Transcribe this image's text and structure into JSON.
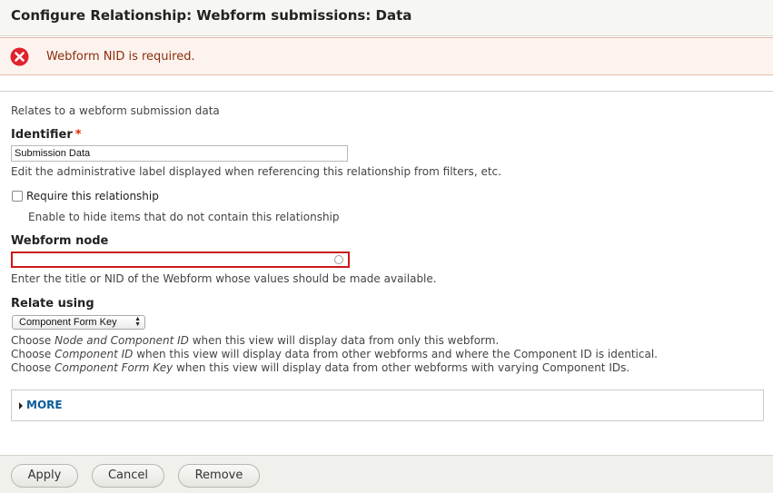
{
  "dialog": {
    "title": "Configure Relationship: Webform submissions: Data"
  },
  "error": {
    "message": "Webform NID is required."
  },
  "form": {
    "intro": "Relates to a webform submission data",
    "identifier": {
      "label": "Identifier",
      "required_marker": "*",
      "value": "Submission Data",
      "description": "Edit the administrative label displayed when referencing this relationship from filters, etc."
    },
    "require_relationship": {
      "label": "Require this relationship",
      "checked": false,
      "description": "Enable to hide items that do not contain this relationship"
    },
    "webform_node": {
      "label": "Webform node",
      "value": "",
      "description": "Enter the title or NID of the Webform whose values should be made available."
    },
    "relate_using": {
      "label": "Relate using",
      "selected": "Component Form Key",
      "help": [
        {
          "pre": "Choose ",
          "em": "Node and Component ID",
          "post": " when this view will display data from only this webform."
        },
        {
          "pre": "Choose ",
          "em": "Component ID",
          "post": " when this view will display data from other webforms and where the Component ID is identical."
        },
        {
          "pre": "Choose ",
          "em": "Component Form Key",
          "post": " when this view will display data from other webforms with varying Component IDs."
        }
      ]
    },
    "more": {
      "label": "MORE"
    }
  },
  "buttons": {
    "apply": "Apply",
    "cancel": "Cancel",
    "remove": "Remove"
  },
  "colors": {
    "error_text": "#8c2e0b",
    "error_background": "#fcf3ee",
    "error_icon": "#e0232e",
    "required_marker": "#e32700",
    "invalid_border": "#cc1a1a",
    "link": "#0a5c9a"
  },
  "icons": {
    "error": "error-x-icon",
    "throbber": "autocomplete-throbber-icon",
    "select_arrows": "select-up-down-arrows-icon",
    "more_arrow": "triangle-right-icon"
  }
}
